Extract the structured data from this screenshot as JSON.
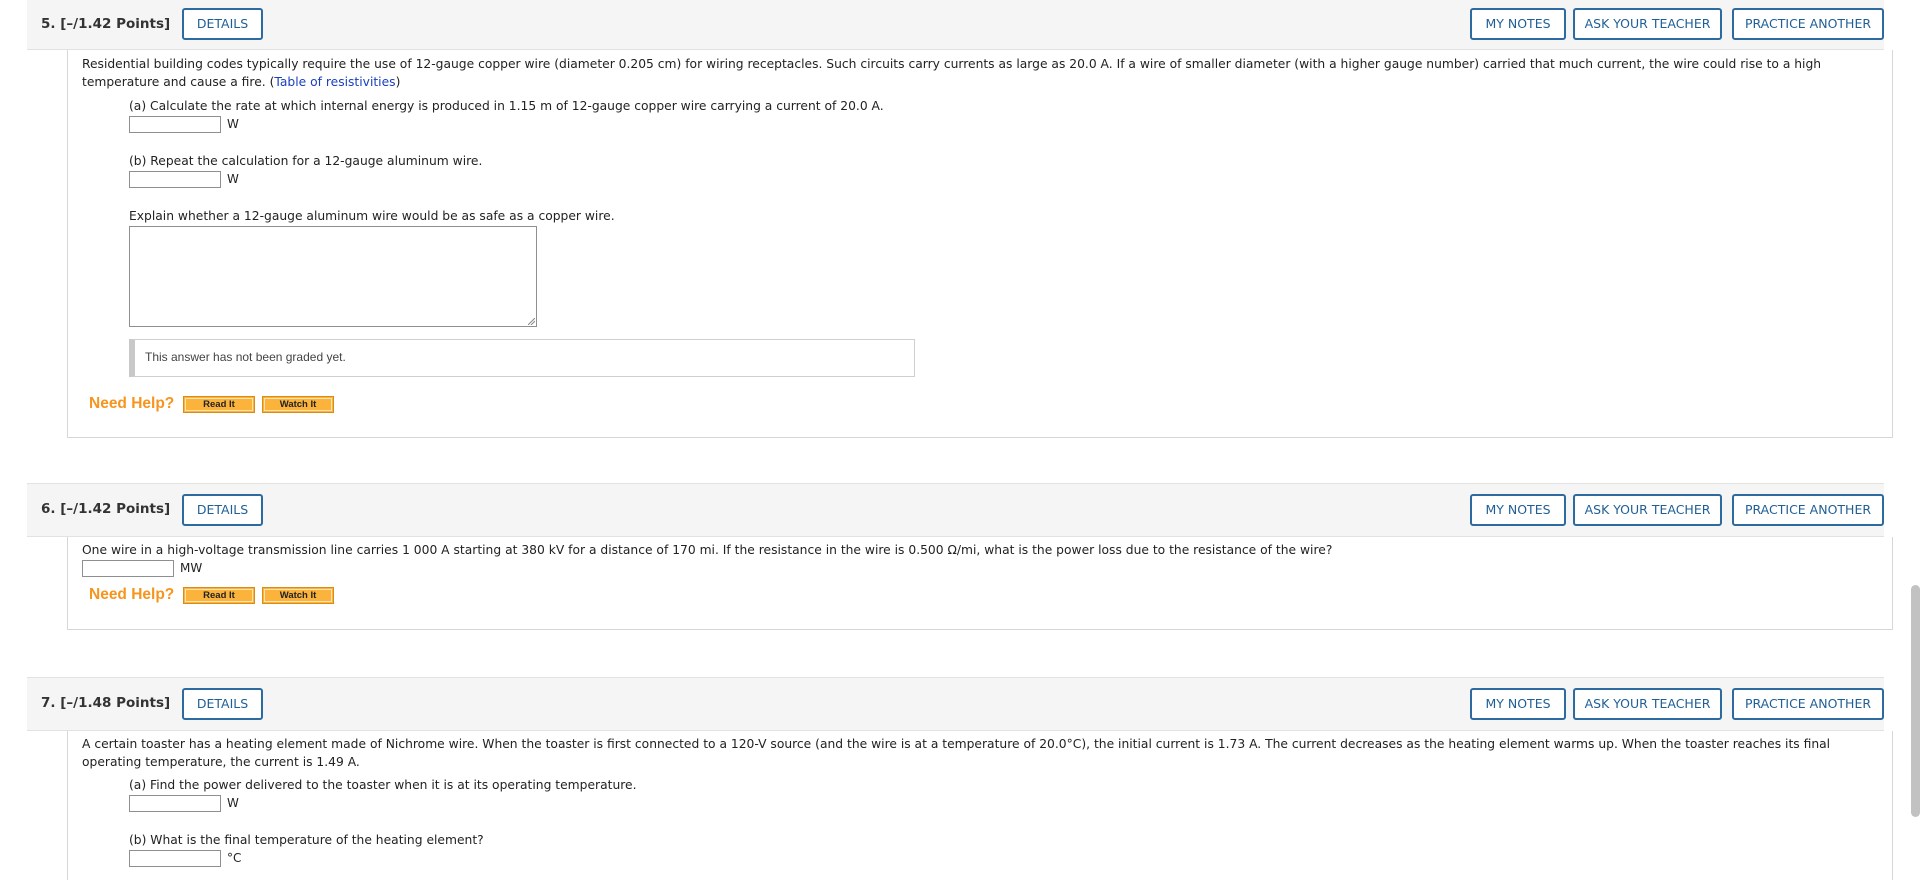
{
  "buttons": {
    "details": "DETAILS",
    "my_notes": "MY NOTES",
    "ask_teacher": "ASK YOUR TEACHER",
    "practice": "PRACTICE ANOTHER"
  },
  "need_help": {
    "label": "Need Help?",
    "read": "Read It",
    "watch": "Watch It"
  },
  "q5": {
    "title": "5.  [–/1.42 Points]",
    "prompt_text": "Residential building codes typically require the use of 12-gauge copper wire (diameter 0.205 cm) for wiring receptacles. Such circuits carry currents as large as 20.0 A. If a wire of smaller diameter (with a higher gauge number) carried that much current, the wire could rise to a high temperature and cause a fire. (",
    "prompt_link": "Table of resistivities",
    "prompt_close": ")",
    "part_a": "(a) Calculate the rate at which internal energy is produced in 1.15 m of 12-gauge copper wire carrying a current of 20.0 A.",
    "unit_a": "W",
    "part_b": "(b) Repeat the calculation for a 12-gauge aluminum wire.",
    "unit_b": "W",
    "explain": "Explain whether a 12-gauge aluminum wire would be as safe as a copper wire.",
    "not_graded": "This answer has not been graded yet."
  },
  "q6": {
    "title": "6.  [–/1.42 Points]",
    "prompt_text": "One wire in a high-voltage transmission line carries 1 000 A starting at 380 kV for a distance of 170 mi. If the resistance in the wire is 0.500 Ω/mi, what is the power loss due to the resistance of the wire?",
    "unit": "MW"
  },
  "q7": {
    "title": "7.  [–/1.48 Points]",
    "prompt_text": "A certain toaster has a heating element made of Nichrome wire. When the toaster is first connected to a 120-V source (and the wire is at a temperature of 20.0°C), the initial current is 1.73 A. The current decreases as the heating element warms up. When the toaster reaches its final operating temperature, the current is 1.49 A.",
    "part_a": "(a) Find the power delivered to the toaster when it is at its operating temperature.",
    "unit_a": "W",
    "part_b": "(b) What is the final temperature of the heating element?",
    "unit_b": "°C"
  }
}
